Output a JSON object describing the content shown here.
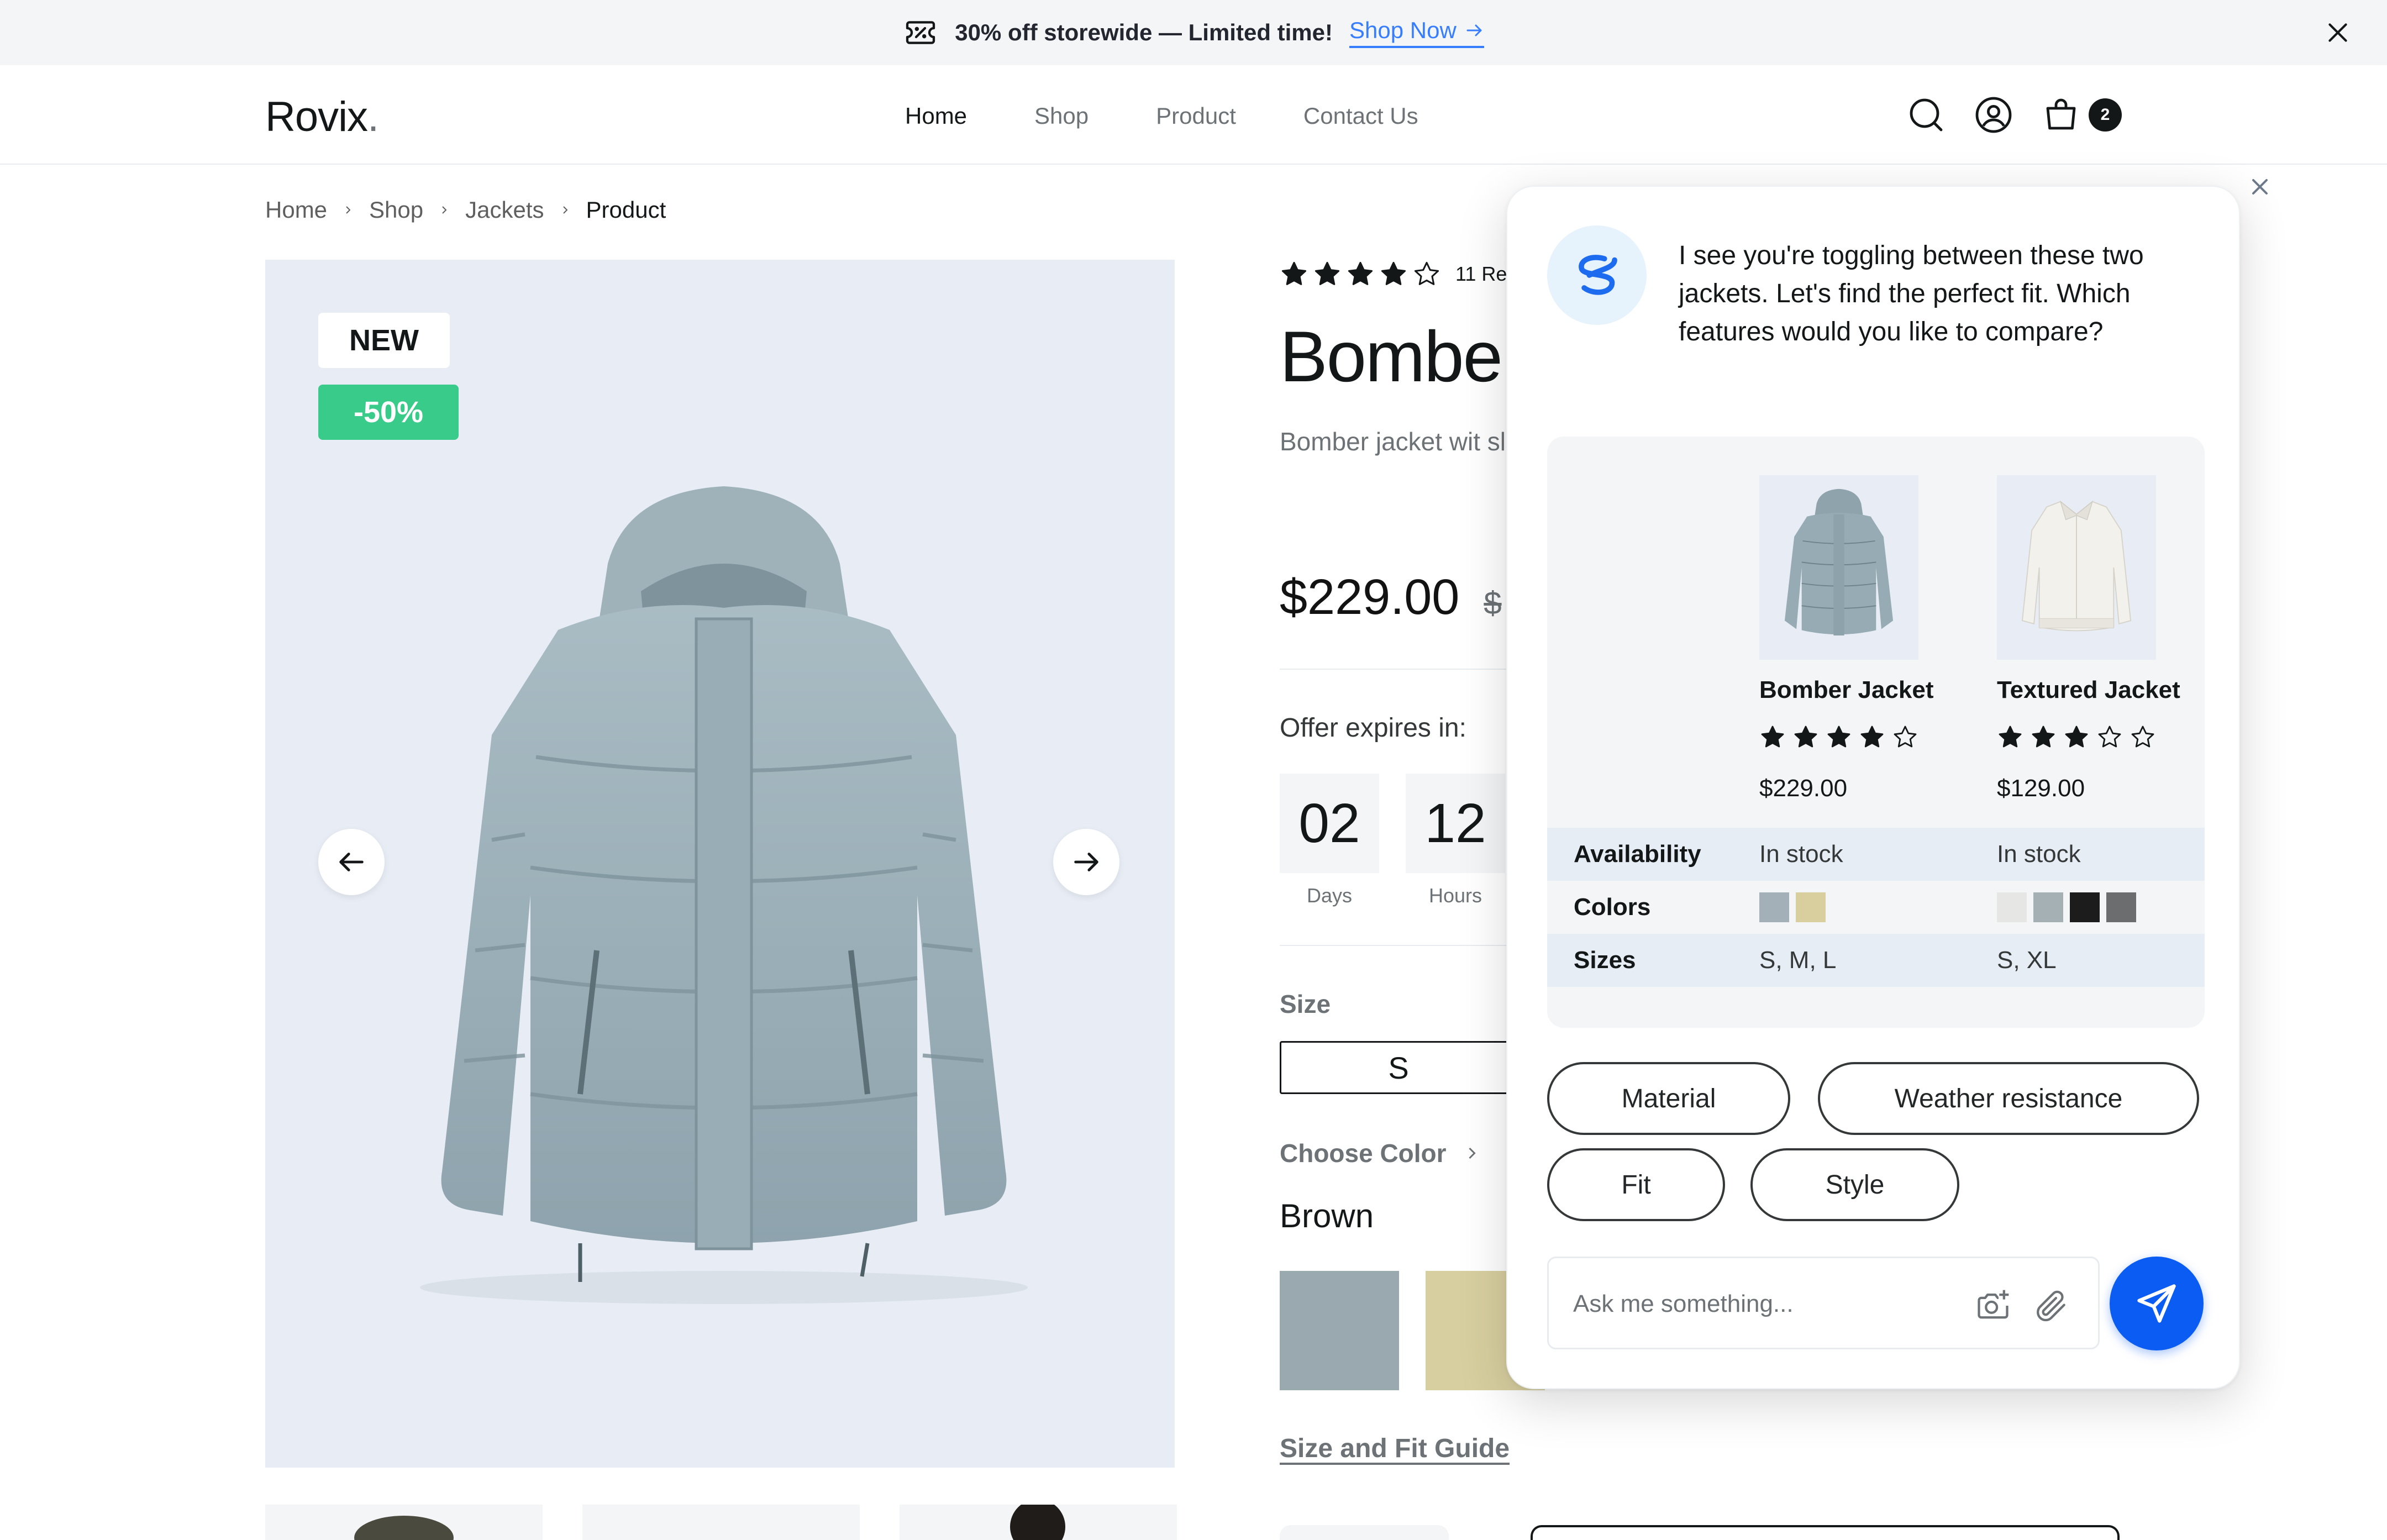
{
  "announcement": {
    "text": "30% off storewide — Limited time!",
    "link": "Shop Now"
  },
  "brand": {
    "name": "Rovix",
    "dot": "."
  },
  "nav": [
    "Home",
    "Shop",
    "Product",
    "Contact Us"
  ],
  "cart_count": "2",
  "breadcrumb": [
    "Home",
    "Shop",
    "Jackets",
    "Product"
  ],
  "gallery": {
    "badge_new": "NEW",
    "badge_discount": "-50%"
  },
  "product": {
    "rating": 4,
    "reviews": "11 Revi",
    "title": "Bomber",
    "description": "Bomber jacket wit sleeves. Flap patc chest. Interior poc",
    "price": "$229.00",
    "old_price": "$",
    "offer_label": "Offer expires in:",
    "countdown": [
      {
        "value": "02",
        "label": "Days"
      },
      {
        "value": "12",
        "label": "Hours"
      }
    ],
    "size_label": "Size",
    "size_selected": "S",
    "color_label": "Choose Color",
    "color_value": "Brown",
    "swatches": [
      "#9aa9b0",
      "#d8cfa0"
    ],
    "fit_guide": "Size and Fit Guide"
  },
  "assistant": {
    "message": "I see you're toggling between these two jackets. Let's find the perfect fit. Which features would you like to compare?",
    "products": [
      {
        "name": "Bomber Jacket",
        "rating": 4,
        "price": "$229.00",
        "availability": "In stock",
        "colors": [
          "#a3b0b8",
          "#d9cf9e"
        ],
        "sizes": "S, M, L"
      },
      {
        "name": "Textured Jacket",
        "rating": 3,
        "price": "$129.00",
        "availability": "In stock",
        "colors": [
          "#e6e6e4",
          "#a4b0b4",
          "#1c1c1c",
          "#6b6d6e"
        ],
        "sizes": "S, XL"
      }
    ],
    "row_labels": {
      "availability": "Availability",
      "colors": "Colors",
      "sizes": "Sizes"
    },
    "chips": [
      "Material",
      "Weather resistance",
      "Fit",
      "Style"
    ],
    "input_placeholder": "Ask me something..."
  }
}
